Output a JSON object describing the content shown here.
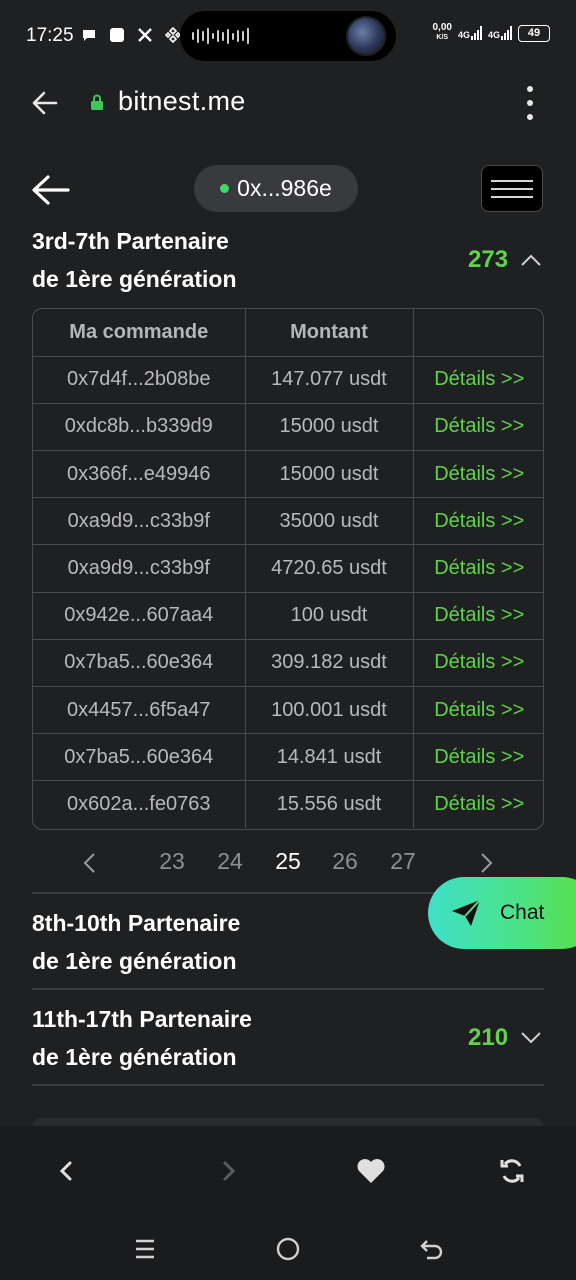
{
  "status_bar": {
    "time": "17:25",
    "net_speed_value": "0,00",
    "net_speed_unit": "K/S",
    "net1": "4G",
    "net2": "4G",
    "battery": "49"
  },
  "browser": {
    "url": "bitnest.me"
  },
  "header": {
    "address": "0x...986e"
  },
  "sections": [
    {
      "title_line1": "3rd-7th Partenaire",
      "title_line2": "de 1ère génération",
      "count": "273",
      "expanded": true
    },
    {
      "title_line1": "8th-10th Partenaire",
      "title_line2": "de 1ère génération",
      "count": "",
      "expanded": false
    },
    {
      "title_line1": "11th-17th Partenaire",
      "title_line2": "de 1ère génération",
      "count": "210",
      "expanded": false
    }
  ],
  "table": {
    "headers": [
      "Ma commande",
      "Montant",
      ""
    ],
    "rows": [
      {
        "order": "0x7d4f...2b08be",
        "amount": "147.077 usdt",
        "details": "Détails >>"
      },
      {
        "order": "0xdc8b...b339d9",
        "amount": "15000 usdt",
        "details": "Détails >>"
      },
      {
        "order": "0x366f...e49946",
        "amount": "15000 usdt",
        "details": "Détails >>"
      },
      {
        "order": "0xa9d9...c33b9f",
        "amount": "35000 usdt",
        "details": "Détails >>"
      },
      {
        "order": "0xa9d9...c33b9f",
        "amount": "4720.65 usdt",
        "details": "Détails >>"
      },
      {
        "order": "0x942e...607aa4",
        "amount": "100 usdt",
        "details": "Détails >>"
      },
      {
        "order": "0x7ba5...60e364",
        "amount": "309.182 usdt",
        "details": "Détails >>"
      },
      {
        "order": "0x4457...6f5a47",
        "amount": "100.001 usdt",
        "details": "Détails >>"
      },
      {
        "order": "0x7ba5...60e364",
        "amount": "14.841 usdt",
        "details": "Détails >>"
      },
      {
        "order": "0x602a...fe0763",
        "amount": "15.556 usdt",
        "details": "Détails >>"
      }
    ]
  },
  "pagination": {
    "pages": [
      "23",
      "24",
      "25",
      "26",
      "27"
    ],
    "current": "25"
  },
  "chat": {
    "label": "Chat"
  },
  "colors": {
    "accent_green": "#5fd34a",
    "background": "#1f2022",
    "chat_gradient_start": "#3fe0c8",
    "chat_gradient_end": "#5ade3a"
  }
}
